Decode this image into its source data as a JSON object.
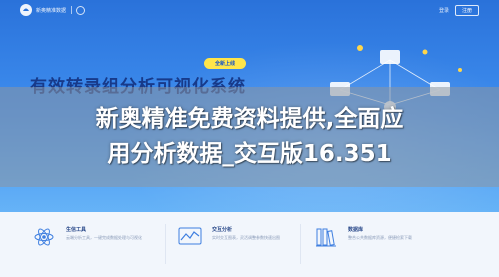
{
  "header": {
    "brand": "新奥精准数据",
    "nav_link": "登录",
    "nav_button": "注册"
  },
  "hero": {
    "promo_badge": "全新上线",
    "title": "有效转录组分析可视化系统"
  },
  "watermark": {
    "line1": "新奥精准免费资料提供,全面应",
    "line2": "用分析数据_交互版16.351"
  },
  "features": [
    {
      "title": "生信工具",
      "desc": "云端分析工具，一键完成数据处理与可视化",
      "icon": "atom-icon"
    },
    {
      "title": "交互分析",
      "desc": "实时交互图表，灵活调整参数快速出图",
      "icon": "chart-icon"
    },
    {
      "title": "数据库",
      "desc": "整合公共数据库资源，便捷检索下载",
      "icon": "library-icon"
    }
  ],
  "colors": {
    "hero_top": "#2a72da",
    "hero_bottom": "#66b3f7",
    "title": "#173a8a",
    "badge_bg": "#ffe54a",
    "feature_bg": "#f2f6fc"
  }
}
